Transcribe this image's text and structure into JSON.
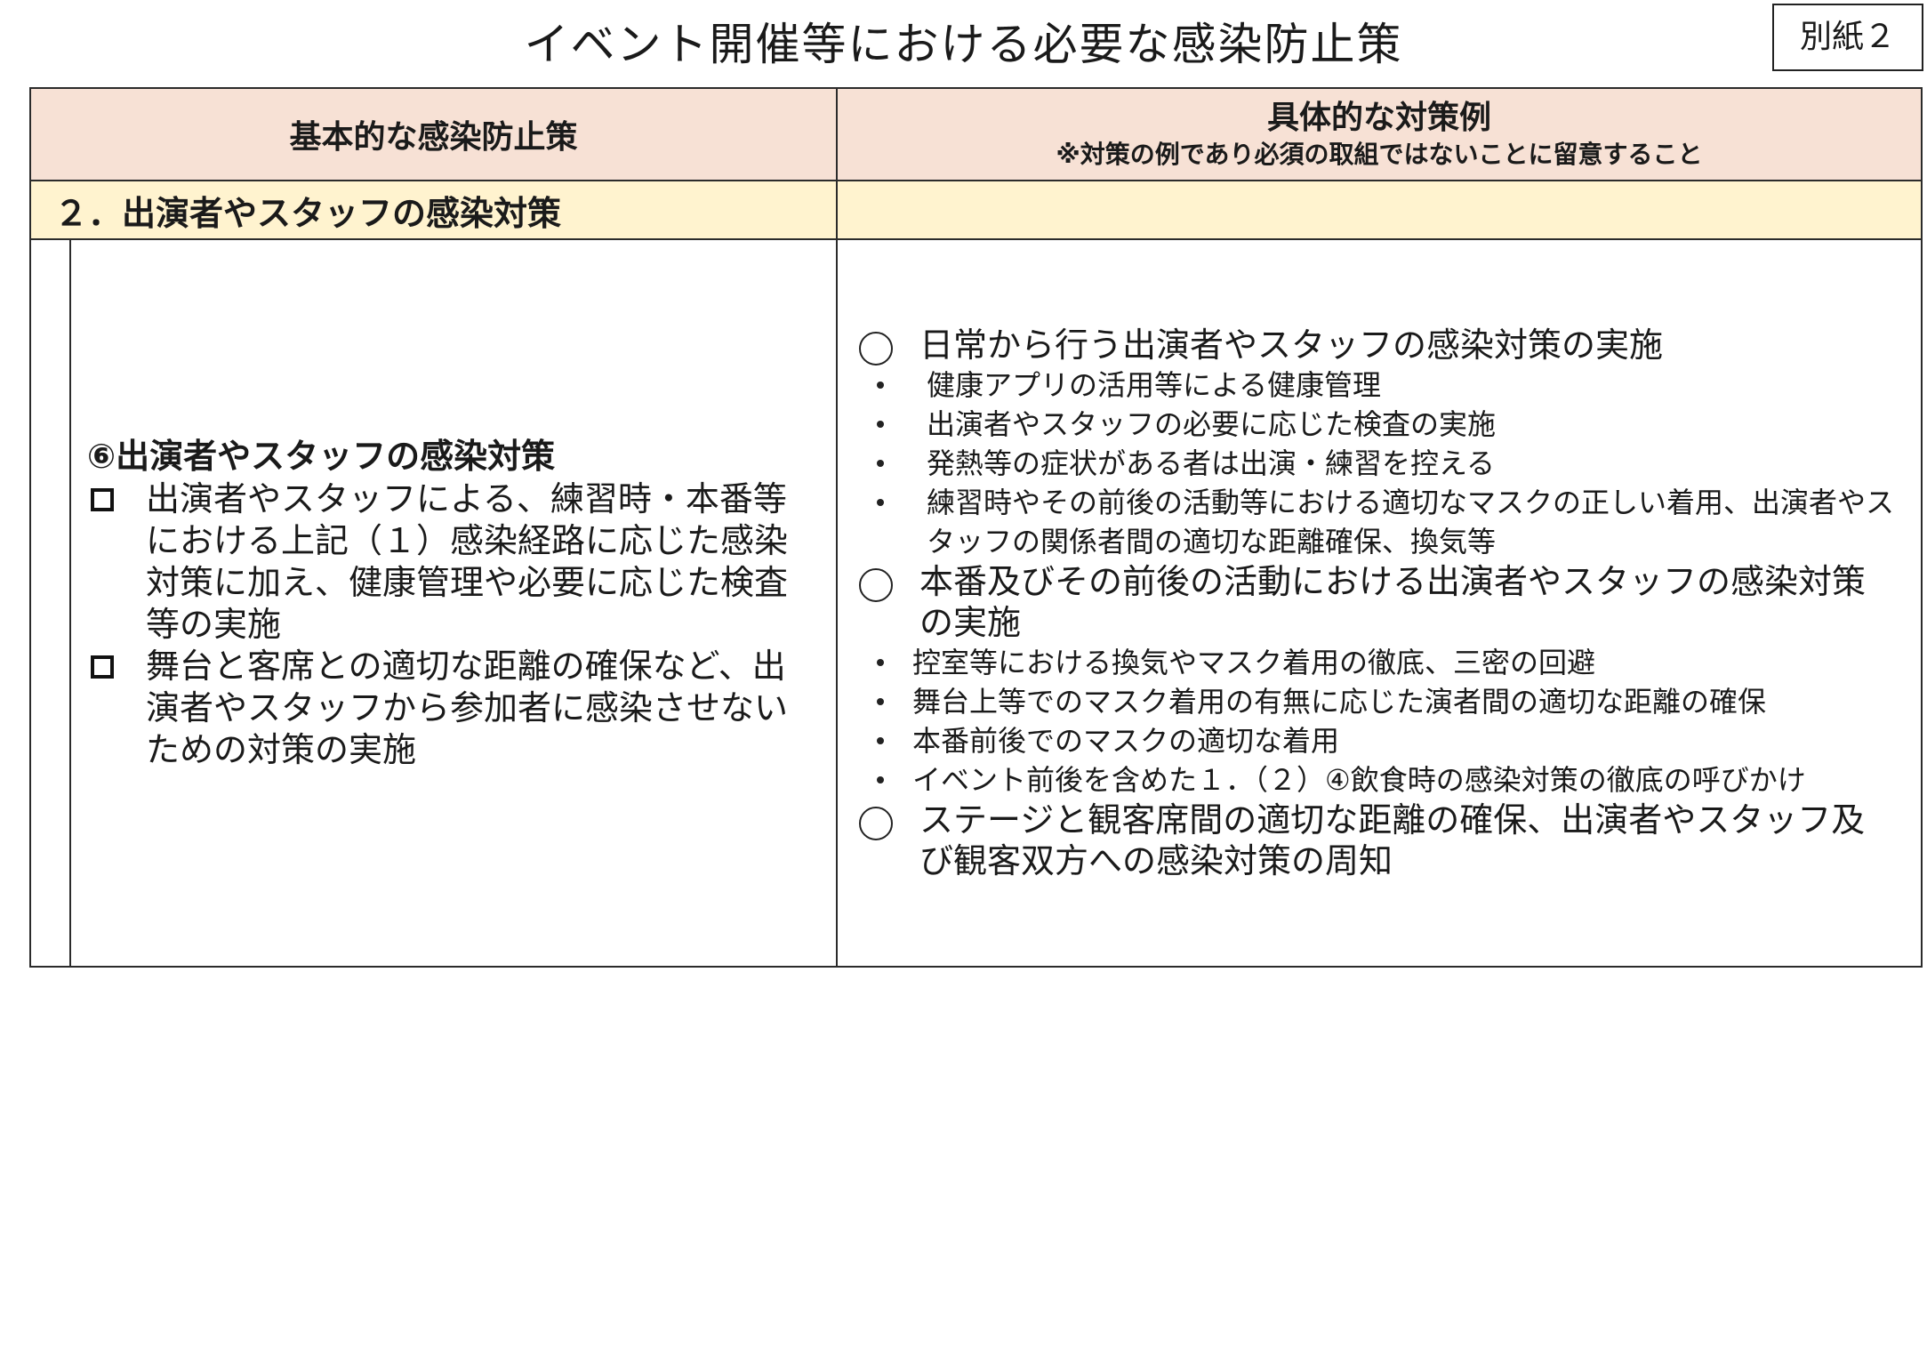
{
  "document": {
    "title": "イベント開催等における必要な感染防止策",
    "attachment_label": "別紙２"
  },
  "table": {
    "header_left": "基本的な感染防止策",
    "header_right_main": "具体的な対策例",
    "header_right_note": "※対策の例であり必須の取組ではないことに留意すること",
    "section_title": "２．出演者やスタッフの感染対策",
    "left": {
      "subheading": "⑥出演者やスタッフの感染対策",
      "items": [
        "出演者やスタッフによる、練習時・本番等における上記（１）感染経路に応じた感染対策に加え、健康管理や必要に応じた検査等の実施",
        "舞台と客席との適切な距離の確保など、出演者やスタッフから参加者に感染させないための対策の実施"
      ]
    },
    "right": {
      "groups": [
        {
          "heading": "日常から行う出演者やスタッフの感染対策の実施",
          "bullets": [
            "健康アプリの活用等による健康管理",
            "出演者やスタッフの必要に応じた検査の実施",
            "発熱等の症状がある者は出演・練習を控える",
            "練習時やその前後の活動等における適切なマスクの正しい着用、出演者やスタッフの関係者間の適切な距離確保、換気等"
          ]
        },
        {
          "heading": "本番及びその前後の活動における出演者やスタッフの感染対策の実施",
          "bullets": [
            "控室等における換気やマスク着用の徹底、三密の回避",
            "舞台上等でのマスク着用の有無に応じた演者間の適切な距離の確保",
            "本番前後でのマスクの適切な着用",
            "イベント前後を含めた１．（２）④飲食時の感染対策の徹底の呼びかけ"
          ]
        },
        {
          "heading": "ステージと観客席間の適切な距離の確保、出演者やスタッフ及び観客双方への感染対策の周知",
          "bullets": []
        }
      ]
    }
  }
}
